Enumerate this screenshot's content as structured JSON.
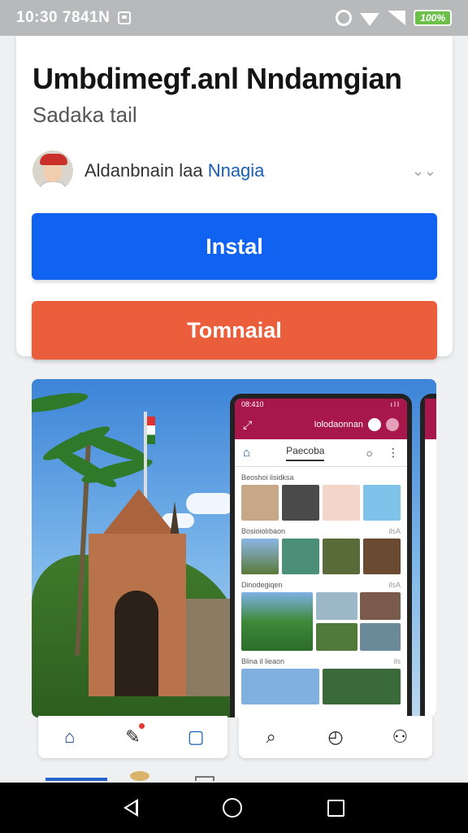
{
  "status_bar": {
    "time": "10:30 7841N",
    "battery": "100%"
  },
  "app": {
    "title": "Umbdimegf.anl Nndamgian",
    "subtitle": "Sadaka tail"
  },
  "developer": {
    "name_prefix": "Aldanbnain laa",
    "name_link": "Nnagia"
  },
  "buttons": {
    "install": "Instal",
    "secondary": "Tomnaial"
  },
  "phone_preview": {
    "status_time": "08:410",
    "status_right": "ıll",
    "back": "⤢",
    "header_title": "Iolodaonnan",
    "tab_label": "Paecoba",
    "section1": "Beoshoi lisidksa",
    "section2": "Bosioiolıbaon",
    "section2_more": "ilsA",
    "section3": "Dinodegiqen",
    "section3_more": "ilsA",
    "section4": "Blina il lieaon",
    "section4_more": "ils"
  },
  "colors": {
    "install": "#0f63f0",
    "secondary": "#eb5e3c",
    "phone_header": "#a8174a"
  },
  "icons": {
    "tabbar_left": [
      "home-icon",
      "edit-icon",
      "square-icon"
    ],
    "tabbar_right": [
      "search-icon",
      "timer-icon",
      "person-icon"
    ]
  }
}
